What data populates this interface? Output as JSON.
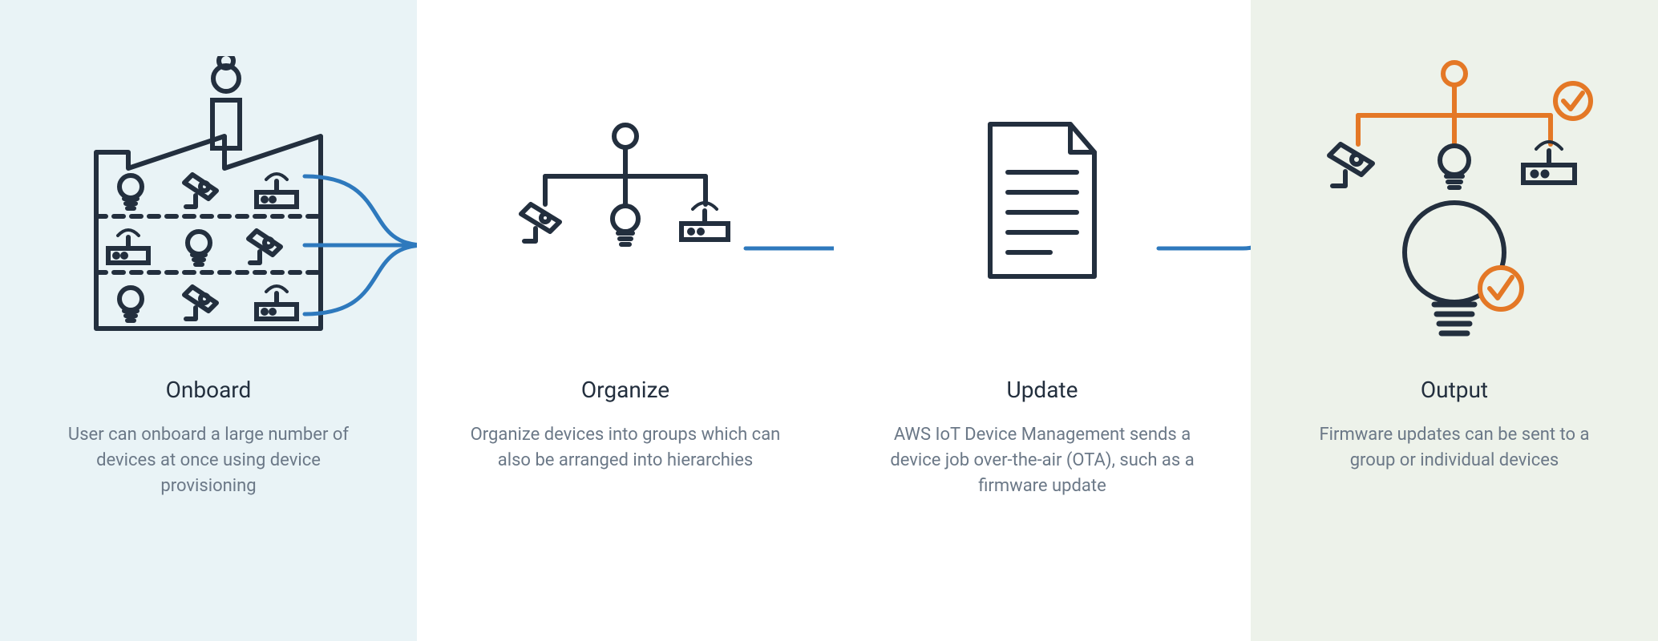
{
  "steps": {
    "onboard": {
      "title": "Onboard",
      "desc": "User can onboard a large number of devices at once using device provisioning"
    },
    "organize": {
      "title": "Organize",
      "desc": "Organize devices into groups which can also be arranged into hierarchies"
    },
    "update": {
      "title": "Update",
      "desc": "AWS IoT Device Management sends a device job over-the-air (OTA), such as a firmware update"
    },
    "output": {
      "title": "Output",
      "desc": "Firmware updates can be sent to a group or individual devices"
    }
  },
  "colors": {
    "stroke": "#232f3e",
    "arrow": "#2e79bd",
    "accent": "#e47826",
    "bg_onboard": "#e9f3f6",
    "bg_output": "#edf2ea"
  },
  "icons": {
    "factory": "onboard-factory-icon",
    "hierarchy": "organize-hierarchy-icon",
    "document": "update-document-icon",
    "output_devices": "output-devices-icon"
  }
}
